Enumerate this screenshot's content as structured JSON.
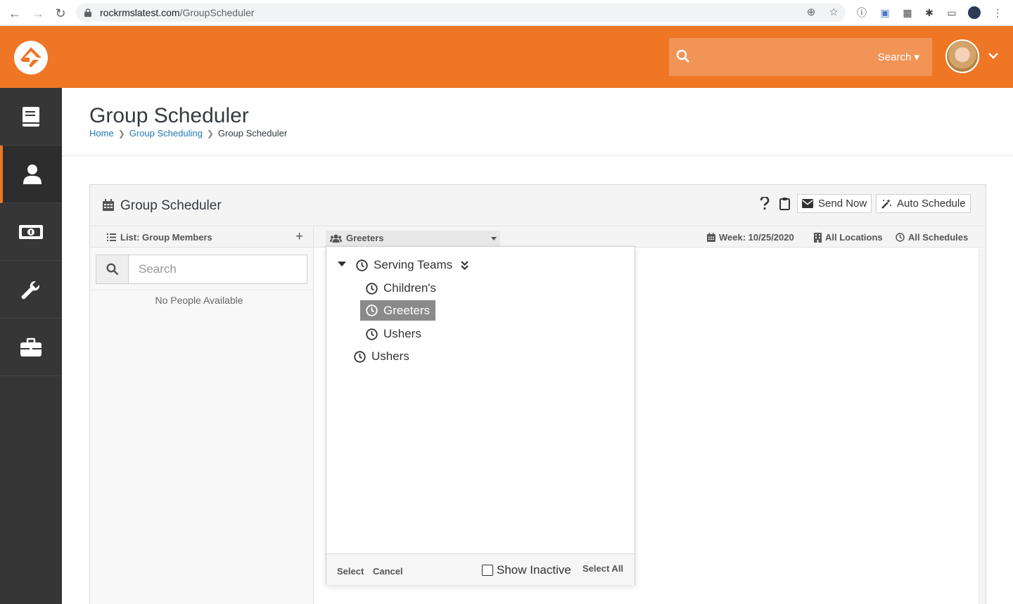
{
  "browser": {
    "url_host": "rockrmslatest.com",
    "url_path": "/GroupScheduler"
  },
  "header": {
    "search_label": "Search"
  },
  "page": {
    "title": "Group Scheduler",
    "breadcrumb": [
      "Home",
      "Group Scheduling",
      "Group Scheduler"
    ]
  },
  "panel": {
    "title": "Group Scheduler",
    "help_icon": "question-icon",
    "clipboard_icon": "clipboard-icon",
    "send_now_label": "Send Now",
    "auto_schedule_label": "Auto Schedule"
  },
  "left": {
    "list_title": "List: Group Members",
    "search_placeholder": "Search",
    "empty_text": "No People Available"
  },
  "right": {
    "group_picker_value": "Greeters",
    "week_label": "Week: 10/25/2020",
    "locations_label": "All Locations",
    "schedules_label": "All Schedules"
  },
  "group_tree": {
    "root": "Serving Teams",
    "children": [
      "Children's",
      "Greeters",
      "Ushers"
    ],
    "sibling": "Ushers",
    "selected": "Greeters"
  },
  "dropdown_footer": {
    "select_label": "Select",
    "cancel_label": "Cancel",
    "show_inactive_label": "Show Inactive",
    "select_all_label": "Select All"
  },
  "colors": {
    "brand_orange": "#ee7625",
    "sidebar": "#363636",
    "link_blue": "#1f78b4"
  }
}
